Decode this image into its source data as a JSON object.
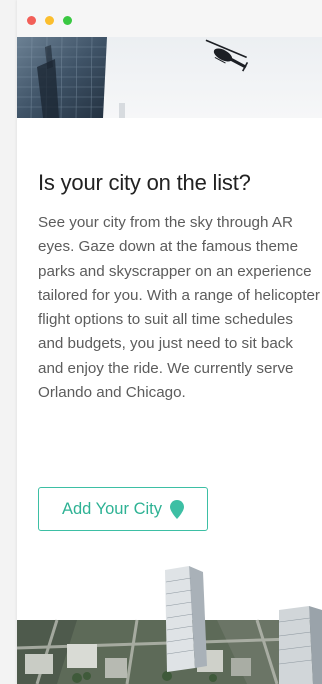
{
  "window": {
    "controls": [
      "close",
      "minimize",
      "zoom"
    ]
  },
  "hero": {
    "image": "helicopter-over-skyscraper",
    "icon": "helicopter-icon"
  },
  "section": {
    "heading": "Is your city on the list?",
    "body": "See your city from the sky through AR eyes. Gaze down at the famous theme parks and skyscrapper on an experience tailored for you. With a range of helicopter flight options to suit all time schedules and budgets, you just need to sit back and enjoy the ride. We currently serve Orlando and Chicago.",
    "cta_label": "Add Your City",
    "cta_icon": "map-pin-icon"
  },
  "footer_image": {
    "image": "aerial-city-view"
  },
  "colors": {
    "accent": "#3dbfa4",
    "heading": "#222222",
    "body": "#5c5c5c",
    "close": "#f25f58",
    "minimize": "#fbbe2e",
    "zoom": "#3ac842"
  }
}
